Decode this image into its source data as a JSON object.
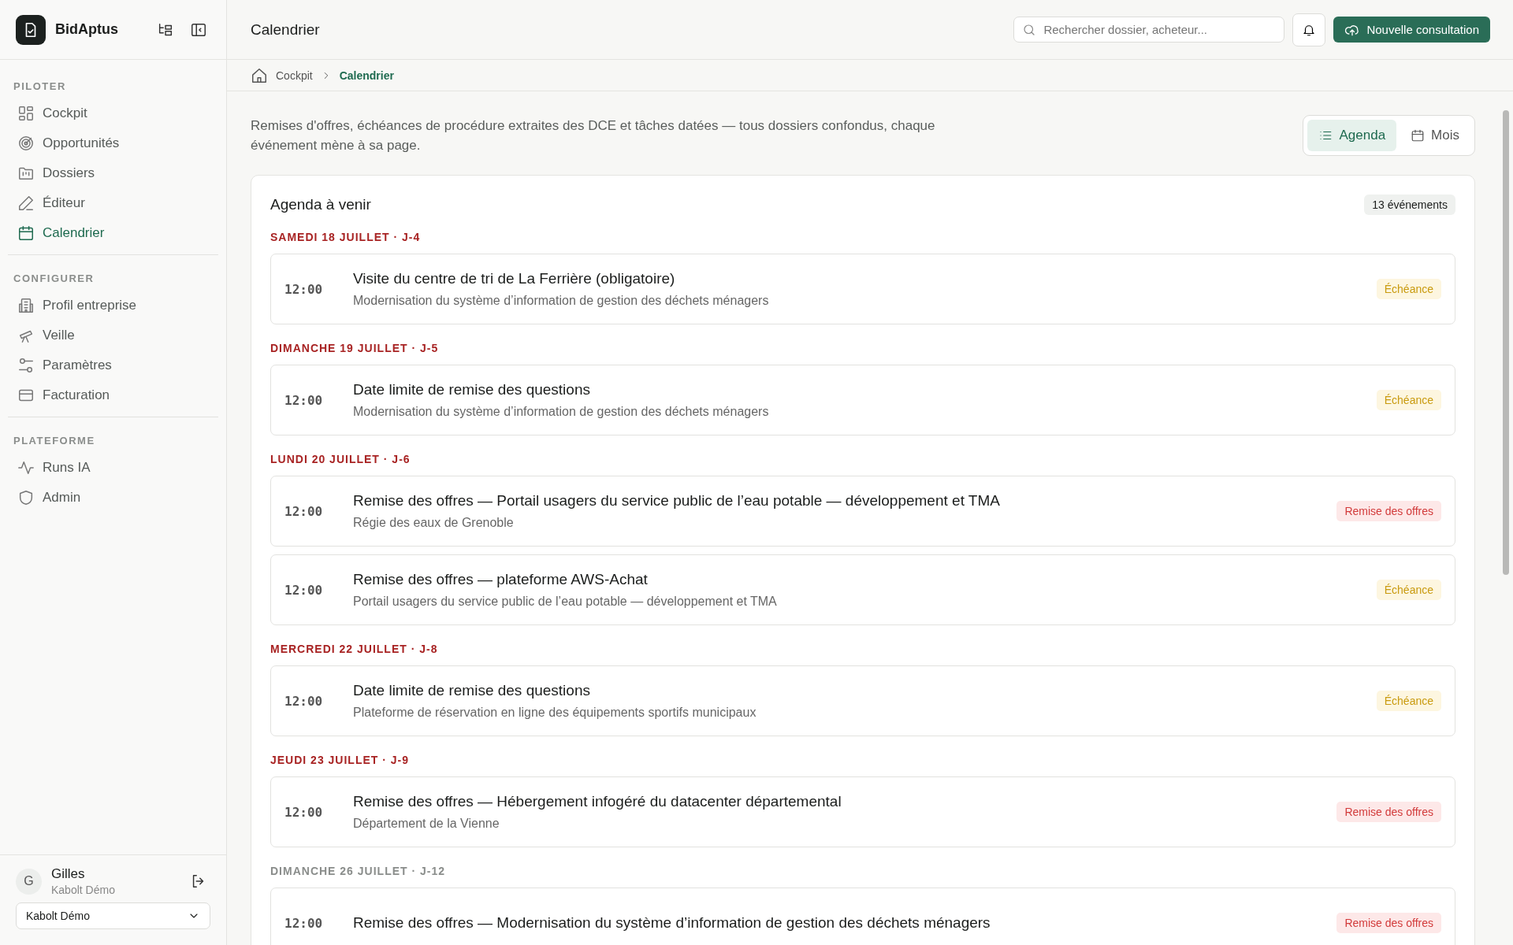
{
  "brand": {
    "name": "BidAptus"
  },
  "sidebar": {
    "sections": [
      {
        "title": "PILOTER",
        "items": [
          {
            "label": "Cockpit",
            "kind": "grid",
            "selected": false
          },
          {
            "label": "Opportunités",
            "kind": "radar",
            "selected": false
          },
          {
            "label": "Dossiers",
            "kind": "folder",
            "selected": false
          },
          {
            "label": "Éditeur",
            "kind": "pen",
            "selected": false
          },
          {
            "label": "Calendrier",
            "kind": "calendar",
            "selected": true
          }
        ]
      },
      {
        "title": "CONFIGURER",
        "items": [
          {
            "label": "Profil entreprise",
            "kind": "building",
            "selected": false
          },
          {
            "label": "Veille",
            "kind": "telescope",
            "selected": false
          },
          {
            "label": "Paramètres",
            "kind": "sliders",
            "selected": false
          },
          {
            "label": "Facturation",
            "kind": "card",
            "selected": false
          }
        ]
      },
      {
        "title": "PLATEFORME",
        "items": [
          {
            "label": "Runs IA",
            "kind": "pulse",
            "selected": false
          },
          {
            "label": "Admin",
            "kind": "shield",
            "selected": false
          }
        ]
      }
    ]
  },
  "user": {
    "initial": "G",
    "name": "Gilles",
    "org": "Kabolt Démo",
    "workspace": "Kabolt Démo"
  },
  "header": {
    "title": "Calendrier",
    "search_placeholder": "Rechercher dossier, acheteur...",
    "new_button": "Nouvelle consultation"
  },
  "breadcrumb": [
    {
      "label": "Cockpit",
      "selected": false
    },
    {
      "label": "Calendrier",
      "selected": true
    }
  ],
  "intro": "Remises d'offres, échéances de procédure extraites des DCE et tâches datées — tous dossiers confondus, chaque événement mène à sa page.",
  "views": [
    {
      "label": "Agenda",
      "kind": "list",
      "selected": true
    },
    {
      "label": "Mois",
      "kind": "calendar",
      "selected": false
    }
  ],
  "agenda": {
    "title": "Agenda à venir",
    "count": "13 événements",
    "days": [
      {
        "label": "SAMEDI 18 JUILLET · J-4",
        "urgent": true,
        "events": [
          {
            "time": "12:00",
            "title": "Visite du centre de tri de La Ferrière (obligatoire)",
            "subtitle": "Modernisation du système d’information de gestion des déchets ménagers",
            "badge": "Échéance",
            "kind": "deadline"
          }
        ]
      },
      {
        "label": "DIMANCHE 19 JUILLET · J-5",
        "urgent": true,
        "events": [
          {
            "time": "12:00",
            "title": "Date limite de remise des questions",
            "subtitle": "Modernisation du système d’information de gestion des déchets ménagers",
            "badge": "Échéance",
            "kind": "deadline"
          }
        ]
      },
      {
        "label": "LUNDI 20 JUILLET · J-6",
        "urgent": true,
        "events": [
          {
            "time": "12:00",
            "title": "Remise des offres — Portail usagers du service public de l’eau potable — développement et TMA",
            "subtitle": "Régie des eaux de Grenoble",
            "badge": "Remise des offres",
            "kind": "submission"
          },
          {
            "time": "12:00",
            "title": "Remise des offres — plateforme AWS-Achat",
            "subtitle": "Portail usagers du service public de l’eau potable — développement et TMA",
            "badge": "Échéance",
            "kind": "deadline"
          }
        ]
      },
      {
        "label": "MERCREDI 22 JUILLET · J-8",
        "urgent": true,
        "events": [
          {
            "time": "12:00",
            "title": "Date limite de remise des questions",
            "subtitle": "Plateforme de réservation en ligne des équipements sportifs municipaux",
            "badge": "Échéance",
            "kind": "deadline"
          }
        ]
      },
      {
        "label": "JEUDI 23 JUILLET · J-9",
        "urgent": true,
        "events": [
          {
            "time": "12:00",
            "title": "Remise des offres — Hébergement infogéré du datacenter départemental",
            "subtitle": "Département de la Vienne",
            "badge": "Remise des offres",
            "kind": "submission"
          }
        ]
      },
      {
        "label": "DIMANCHE 26 JUILLET · J-12",
        "urgent": false,
        "events": [
          {
            "time": "12:00",
            "title": "Remise des offres — Modernisation du système d’information de gestion des déchets ménagers",
            "badge": "Remise des offres",
            "kind": "submission"
          }
        ]
      }
    ]
  }
}
